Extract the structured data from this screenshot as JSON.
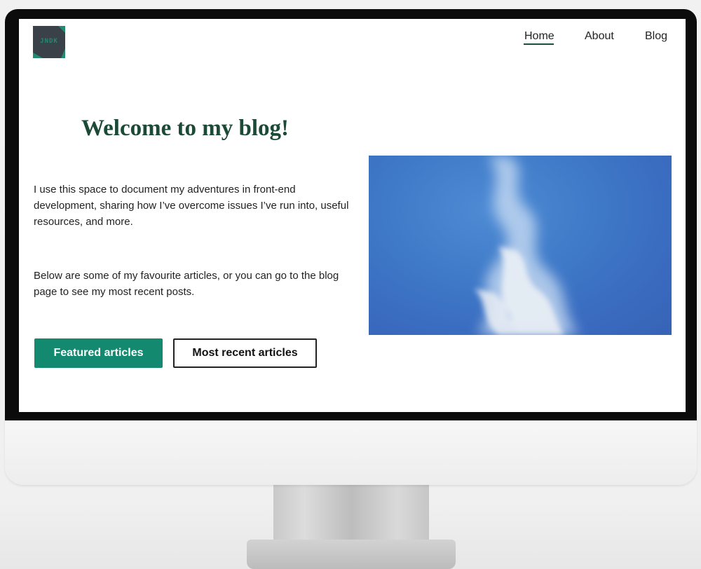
{
  "site": {
    "logo_initials": "JNDK",
    "nav": {
      "items": [
        {
          "label": "Home",
          "active": true
        },
        {
          "label": "About",
          "active": false
        },
        {
          "label": "Blog",
          "active": false
        }
      ]
    },
    "hero": {
      "title": "Welcome to my blog!",
      "paragraphs": [
        "I use this space to document my adventures in front-end development, sharing how I’ve overcome issues I’ve run into, useful resources, and more.",
        "Below are some of my favourite articles, or you can go to the blog page to see my most recent posts."
      ],
      "buttons": {
        "primary": "Featured articles",
        "secondary": "Most recent articles"
      },
      "image_subject": "blue sky with wispy clouds"
    }
  },
  "colors": {
    "accent_green": "#138a70",
    "title_green": "#1b4a36",
    "sky_blue": "#3f7ac8",
    "bezel": "#0b0b0b"
  }
}
